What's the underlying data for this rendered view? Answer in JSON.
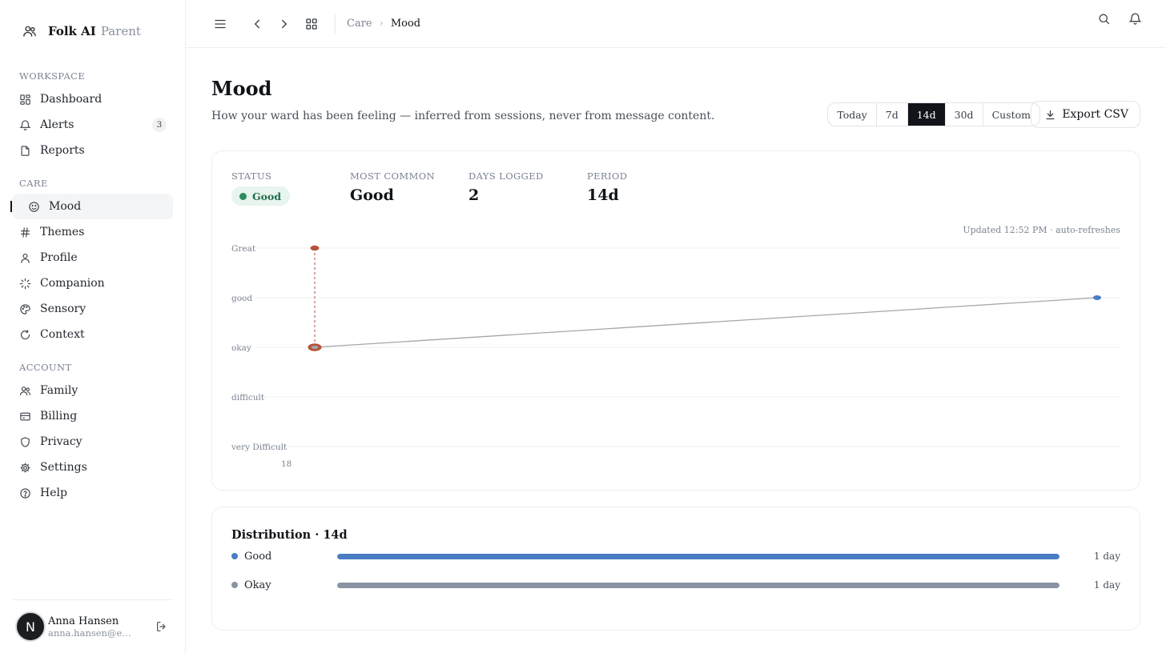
{
  "brand": {
    "name": "Folk AI",
    "role": "Parent"
  },
  "sidebar": {
    "sections": [
      {
        "label": "WORKSPACE",
        "items": [
          {
            "label": "Dashboard",
            "icon": "dashboard-icon"
          },
          {
            "label": "Alerts",
            "icon": "bell-icon",
            "badge": "3"
          },
          {
            "label": "Reports",
            "icon": "file-icon"
          }
        ]
      },
      {
        "label": "CARE",
        "items": [
          {
            "label": "Mood",
            "icon": "smile-icon",
            "active": true
          },
          {
            "label": "Themes",
            "icon": "hash-icon"
          },
          {
            "label": "Profile",
            "icon": "user-icon"
          },
          {
            "label": "Companion",
            "icon": "loader-icon"
          },
          {
            "label": "Sensory",
            "icon": "palette-icon"
          },
          {
            "label": "Context",
            "icon": "refresh-icon"
          }
        ]
      },
      {
        "label": "ACCOUNT",
        "items": [
          {
            "label": "Family",
            "icon": "users-icon"
          },
          {
            "label": "Billing",
            "icon": "credit-card-icon"
          },
          {
            "label": "Privacy",
            "icon": "shield-icon"
          },
          {
            "label": "Settings",
            "icon": "gear-icon"
          },
          {
            "label": "Help",
            "icon": "help-circle-icon"
          }
        ]
      }
    ],
    "user": {
      "initial": "N",
      "name": "Anna Hansen",
      "email": "anna.hansen@email.com"
    }
  },
  "topbar": {
    "breadcrumb": [
      "Care",
      "Mood"
    ]
  },
  "page": {
    "title": "Mood",
    "subtitle": "How your ward has been feeling — inferred from sessions, never from message content.",
    "ranges": [
      "Today",
      "7d",
      "14d",
      "30d",
      "Custom"
    ],
    "active_range": "14d",
    "export_label": "Export CSV"
  },
  "stats": {
    "status_label": "STATUS",
    "status_value": "Good",
    "common_label": "MOST COMMON",
    "common_value": "Good",
    "days_label": "DAYS LOGGED",
    "days_value": "2",
    "period_label": "PERIOD",
    "period_value": "14d"
  },
  "updated": "Updated 12:52 PM · auto-refreshes",
  "chart_data": {
    "type": "line",
    "y_levels": [
      "Great",
      "good",
      "okay",
      "difficult",
      "very Difficult"
    ],
    "x_tick_labels": [
      "18"
    ],
    "points": [
      {
        "x": "18",
        "level": "okay",
        "color": "#b5533a"
      },
      {
        "x": "18",
        "level": "Great",
        "color": "#b5533a"
      },
      {
        "x": "end",
        "level": "good",
        "color": "#4a7cc4"
      }
    ],
    "line_color": "#a3a6ab",
    "grid": true,
    "legend": "none"
  },
  "distribution": {
    "title": "Distribution · 14d",
    "rows": [
      {
        "name": "Good",
        "count": "1 day",
        "color": "#4a7cc4",
        "fraction": 1.0
      },
      {
        "name": "Okay",
        "count": "1 day",
        "color": "#8a93a3",
        "fraction": 1.0
      }
    ]
  }
}
